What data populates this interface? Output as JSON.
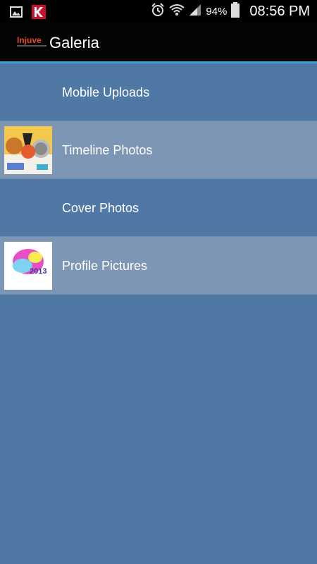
{
  "status_bar": {
    "battery": "94%",
    "time": "08:56 PM"
  },
  "app_bar": {
    "logo_text": "Injuve",
    "title": "Galeria"
  },
  "albums": [
    {
      "label": "Mobile Uploads",
      "has_thumbnail": false
    },
    {
      "label": "Timeline Photos",
      "has_thumbnail": true
    },
    {
      "label": "Cover Photos",
      "has_thumbnail": false
    },
    {
      "label": "Profile Pictures",
      "has_thumbnail": true
    }
  ],
  "thumbnail_text": {
    "profile": "2013"
  }
}
